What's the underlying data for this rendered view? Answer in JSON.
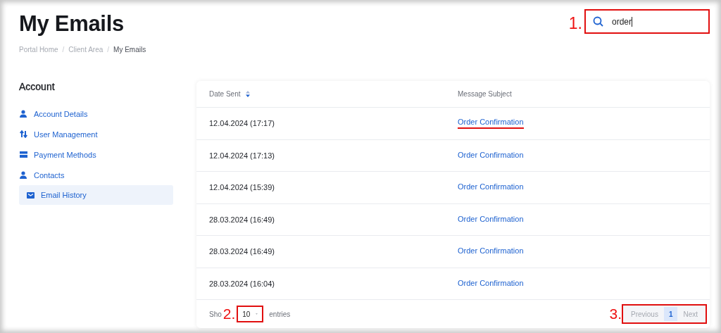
{
  "page": {
    "title": "My Emails"
  },
  "breadcrumb": [
    {
      "label": "Portal Home",
      "current": false
    },
    {
      "separator": "/",
      "label": "Client Area",
      "current": false
    },
    {
      "separator": "/",
      "label": "My Emails",
      "current": true
    }
  ],
  "search": {
    "value": "order",
    "annotation": "1."
  },
  "sidebar": {
    "title": "Account",
    "items": [
      {
        "label": "Account Details",
        "kind": "user",
        "selected": false
      },
      {
        "label": "User Management",
        "kind": "arrows",
        "selected": false
      },
      {
        "label": "Payment Methods",
        "kind": "card",
        "selected": false
      },
      {
        "label": "Contacts",
        "kind": "user",
        "selected": false
      },
      {
        "label": "Email History",
        "kind": "envelope",
        "selected": true
      }
    ]
  },
  "table": {
    "columns": [
      {
        "label": "Date Sent",
        "sortable": true
      },
      {
        "label": "Message Subject",
        "sortable": false
      }
    ],
    "rows": [
      {
        "date": "12.04.2024 (17:17)",
        "subject": "Order Confirmation",
        "underlined": true
      },
      {
        "date": "12.04.2024 (17:13)",
        "subject": "Order Confirmation",
        "underlined": false
      },
      {
        "date": "12.04.2024 (15:39)",
        "subject": "Order Confirmation",
        "underlined": false
      },
      {
        "date": "28.03.2024 (16:49)",
        "subject": "Order Confirmation",
        "underlined": false
      },
      {
        "date": "28.03.2024 (16:49)",
        "subject": "Order Confirmation",
        "underlined": false
      },
      {
        "date": "28.03.2024 (16:04)",
        "subject": "Order Confirmation",
        "underlined": false
      }
    ]
  },
  "footer": {
    "show_label": "Sho",
    "page_size": "10",
    "page_size_annotation": "2.",
    "entries_label": "entries"
  },
  "pagination": {
    "previous": "Previous",
    "pages": [
      {
        "label": "1",
        "selected": true
      }
    ],
    "next": "Next",
    "annotation": "3."
  }
}
